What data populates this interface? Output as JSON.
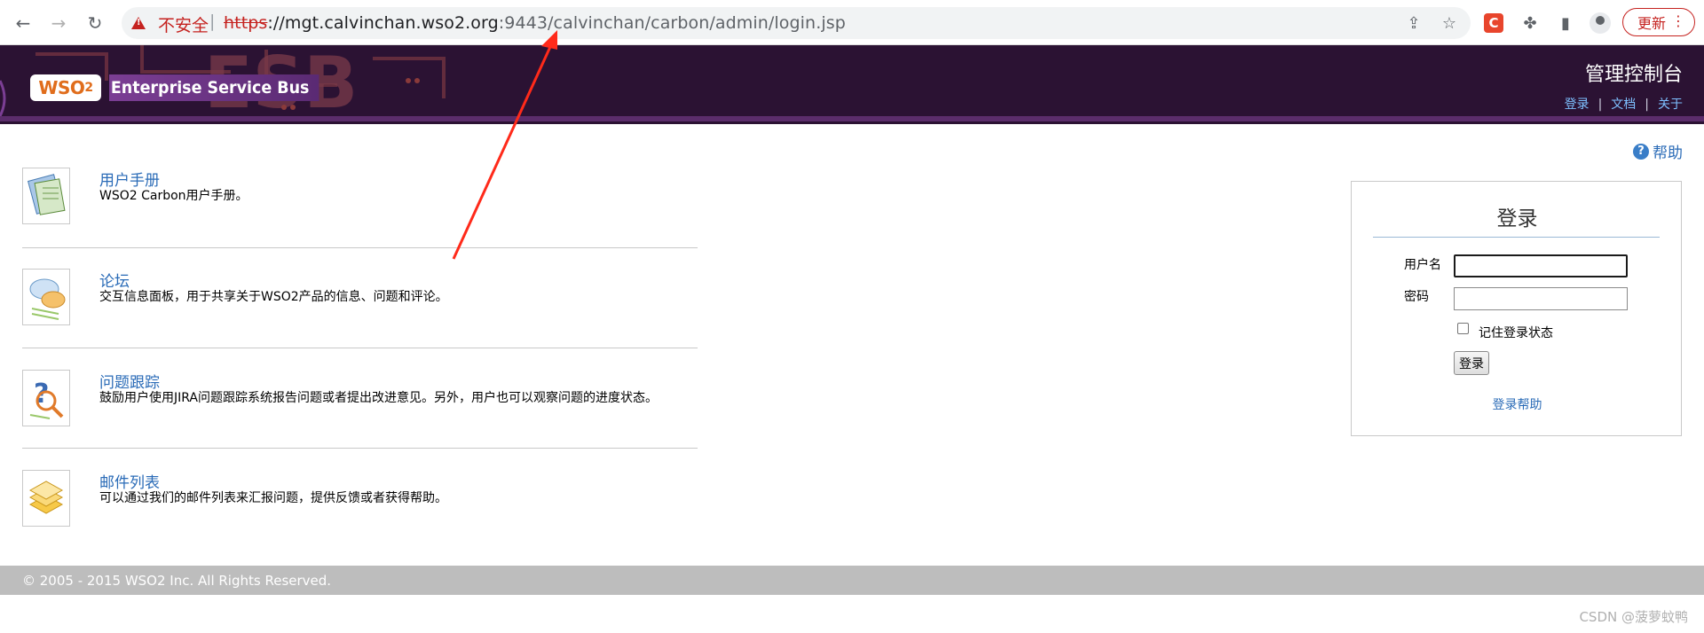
{
  "browser": {
    "back_icon": "arrow-left-icon",
    "forward_icon": "arrow-right-icon",
    "reload_icon": "reload-icon",
    "security_label": "不安全",
    "url_scheme": "https",
    "url_host": "://mgt.calvinchan.wso2.org",
    "url_rest": ":9443/calvinchan/carbon/admin/login.jsp",
    "update_label": "更新",
    "accent_color": "#c5221f"
  },
  "header": {
    "logo_text": "WSO",
    "logo_sub": "2",
    "product_name": "Enterprise Service Bus",
    "console_title": "管理控制台",
    "links": [
      "登录",
      "文档",
      "关于"
    ],
    "separator": "|",
    "bg_color": "#2b1233"
  },
  "help": {
    "label": "帮助"
  },
  "resources": [
    {
      "title": "用户手册",
      "desc": "WSO2 Carbon用户手册。",
      "icon": "manual-icon"
    },
    {
      "title": "论坛",
      "desc": "交互信息面板，用于共享关于WSO2产品的信息、问题和评论。",
      "icon": "forum-icon"
    },
    {
      "title": "问题跟踪",
      "desc": "鼓励用户使用JIRA问题跟踪系统报告问题或者提出改进意见。另外，用户也可以观察问题的进度状态。",
      "icon": "issue-tracker-icon"
    },
    {
      "title": "邮件列表",
      "desc": "可以通过我们的邮件列表来汇报问题，提供反馈或者获得帮助。",
      "icon": "mailing-list-icon"
    }
  ],
  "login": {
    "title": "登录",
    "username_label": "用户名",
    "username_value": "",
    "password_label": "密码",
    "password_value": "",
    "remember_label": "记住登录状态",
    "remember_checked": false,
    "submit_label": "登录",
    "help_link": "登录帮助"
  },
  "footer": {
    "copyright": "© 2005 - 2015 WSO2 Inc. All Rights Reserved."
  },
  "watermark": "CSDN @菠萝蚊鸭"
}
